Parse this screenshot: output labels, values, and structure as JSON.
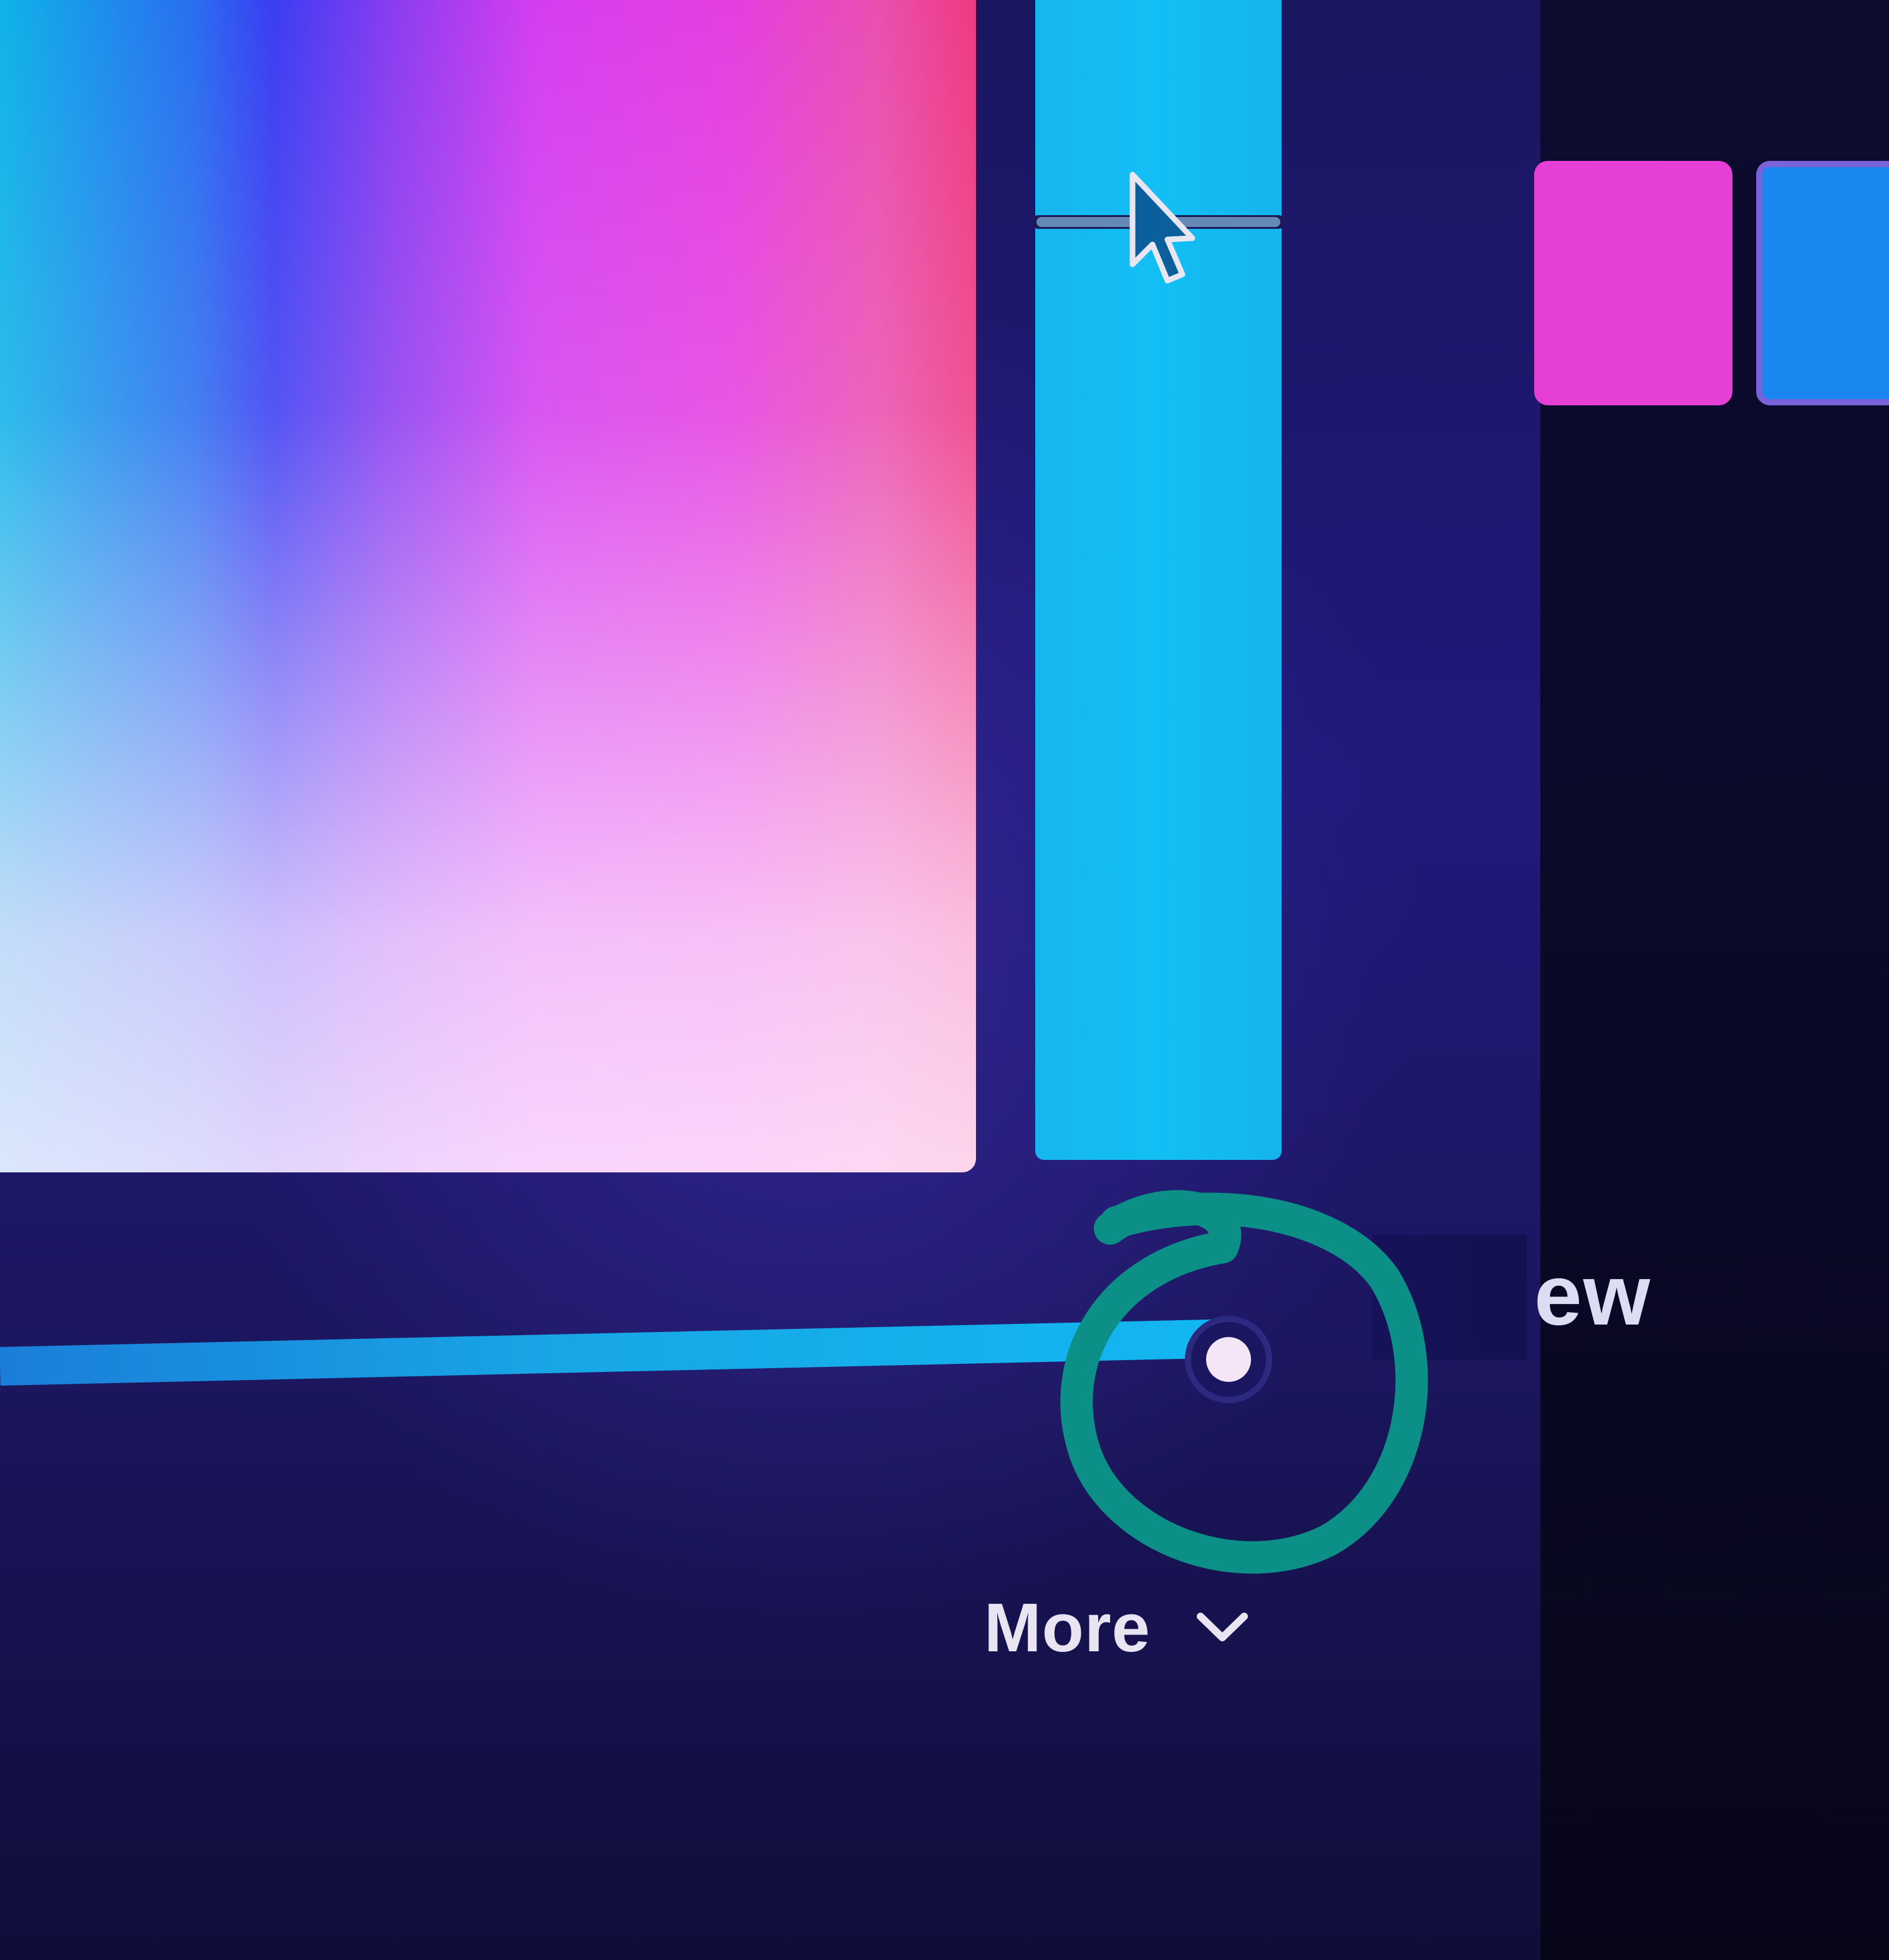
{
  "dialog": {
    "preview_partial_label": "ew",
    "more_label": "More",
    "opacity_percent": 98
  },
  "colors": {
    "new_swatch": "#e63fd6",
    "current_swatch": "#1a86f0",
    "hue_slider": "#11bff5",
    "annotation": "#0b8f86"
  },
  "icons": {
    "cursor": "mouse-pointer-icon",
    "chevron": "chevron-down-icon"
  }
}
